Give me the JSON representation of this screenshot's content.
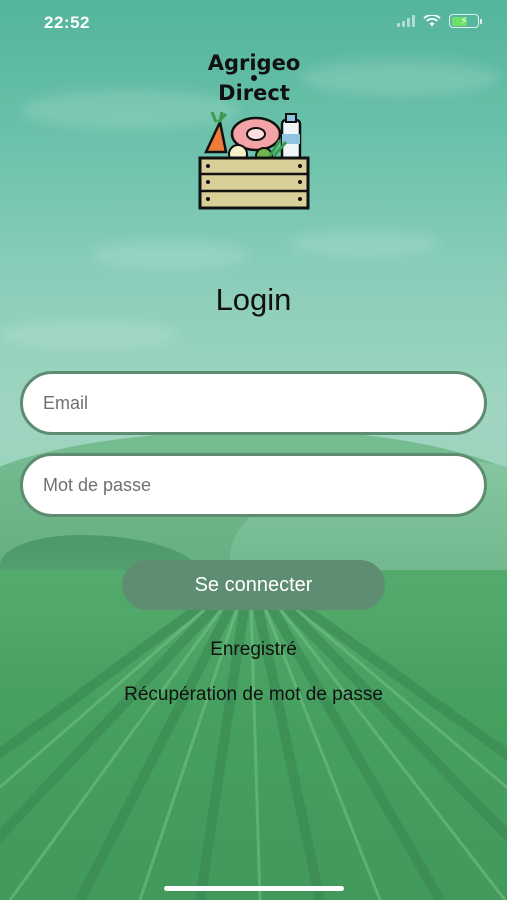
{
  "status_bar": {
    "time": "22:52"
  },
  "logo": {
    "line1": "Agrigeo",
    "line2": "Direct"
  },
  "login": {
    "title": "Login",
    "email_placeholder": "Email",
    "password_placeholder": "Mot de passe",
    "submit_label": "Se connecter",
    "register_link": "Enregistré",
    "recover_link": "Récupération de mot de passe"
  },
  "colors": {
    "button": "#5f8d72",
    "input_border": "#5e8c70",
    "background": "#5fb89a"
  }
}
